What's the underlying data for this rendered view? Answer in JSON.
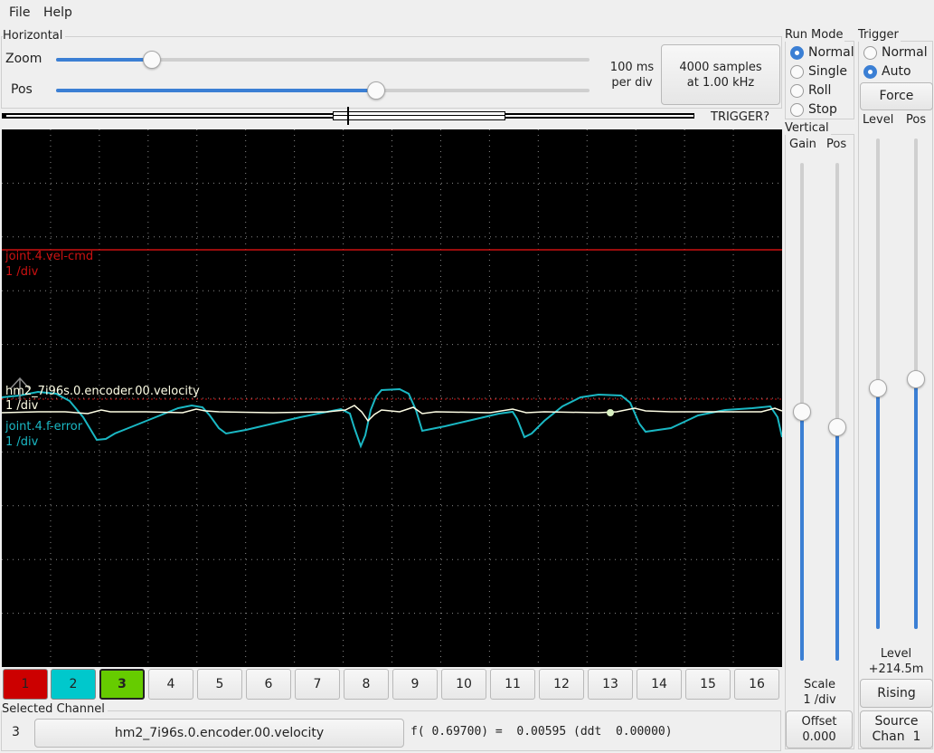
{
  "menu": {
    "file": "File",
    "help": "Help"
  },
  "horizontal": {
    "title": "Horizontal",
    "zoom_label": "Zoom",
    "pos_label": "Pos",
    "zoom_level": 0.18,
    "pos_level": 0.6,
    "scale_line1": "100 ms",
    "scale_line2": "per div",
    "samples_line1": "4000 samples",
    "samples_line2": "at 1.00 kHz",
    "trigger_status": "TRIGGER?"
  },
  "run_mode": {
    "title": "Run Mode",
    "options": [
      "Normal",
      "Single",
      "Roll",
      "Stop"
    ],
    "selected": "Normal"
  },
  "trigger": {
    "title": "Trigger",
    "options": [
      "Normal",
      "Auto"
    ],
    "selected": "Auto",
    "force_label": "Force",
    "level_label": "Level",
    "pos_label": "Pos",
    "level_slider": 0.49,
    "pos_slider": 0.51,
    "level_title": "Level",
    "level_value": "+214.5m",
    "edge_label": "Rising",
    "source_line1": "Source",
    "source_line2": "Chan  1"
  },
  "vertical": {
    "title": "Vertical",
    "gain_label": "Gain",
    "pos_label": "Pos",
    "gain_slider": 0.5,
    "pos_slider": 0.47,
    "scale_title": "Scale",
    "scale_value": "1 /div",
    "offset_title": "Offset",
    "offset_value": "0.000"
  },
  "traces": [
    {
      "name": "joint.4.vel-cmd",
      "scale": "1 /div",
      "color": "#cc1111"
    },
    {
      "name": "hm2_7i96s.0.encoder.00.velocity",
      "scale": "1 /div",
      "color": "#ffffe6"
    },
    {
      "name": "joint.4.f-error",
      "scale": "1 /div",
      "color": "#1ab8c4"
    }
  ],
  "channels": {
    "buttons": [
      "1",
      "2",
      "3",
      "4",
      "5",
      "6",
      "7",
      "8",
      "9",
      "10",
      "11",
      "12",
      "13",
      "14",
      "15",
      "16"
    ],
    "colors": {
      "1": "#cc0000",
      "2": "#00c8cc",
      "3": "#66cc00"
    },
    "selected": "3"
  },
  "selected_channel": {
    "title": "Selected Channel",
    "number": "3",
    "name": "hm2_7i96s.0.encoder.00.velocity",
    "readout": "f( 0.69700) =  0.00595 (ddt  0.00000)"
  }
}
